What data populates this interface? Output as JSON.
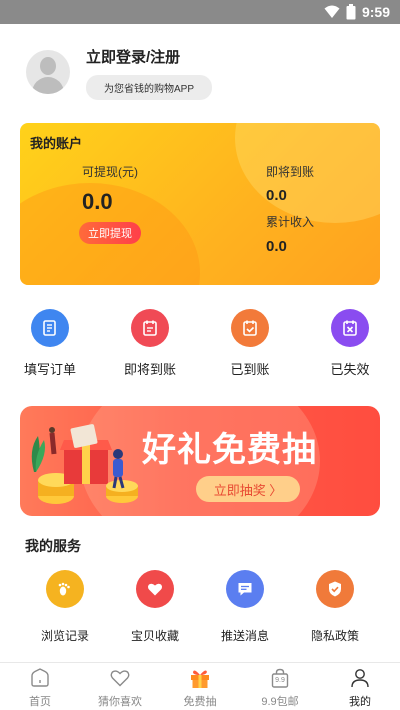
{
  "status_bar": {
    "time": "9:59"
  },
  "profile": {
    "title": "立即登录/注册",
    "slogan": "为您省钱的购物APP"
  },
  "account": {
    "title": "我的账户",
    "withdrawable_label": "可提现(元)",
    "withdrawable_value": "0.0",
    "withdraw_button": "立即提现",
    "pending_label": "即将到账",
    "pending_value": "0.0",
    "total_label": "累计收入",
    "total_value": "0.0"
  },
  "orders": [
    {
      "label": "填写订单",
      "icon": "edit-order-icon",
      "color": "#3f86f0"
    },
    {
      "label": "即将到账",
      "icon": "pending-icon",
      "color": "#f04a55"
    },
    {
      "label": "已到账",
      "icon": "received-icon",
      "color": "#f27a3a"
    },
    {
      "label": "已失效",
      "icon": "expired-icon",
      "color": "#8a4cf0"
    }
  ],
  "banner": {
    "title": "好礼免费抽",
    "button": "立即抽奖 〉"
  },
  "services": {
    "title": "我的服务",
    "items": [
      {
        "label": "浏览记录",
        "icon": "footprint-icon",
        "color": "#f5b320"
      },
      {
        "label": "宝贝收藏",
        "icon": "heart-icon",
        "color": "#f04a4a"
      },
      {
        "label": "推送消息",
        "icon": "message-icon",
        "color": "#5b7ef0"
      },
      {
        "label": "隐私政策",
        "icon": "shield-icon",
        "color": "#f07a3a"
      }
    ]
  },
  "tabs": [
    {
      "label": "首页",
      "icon": "home-icon"
    },
    {
      "label": "猜你喜欢",
      "icon": "heart-outline-icon"
    },
    {
      "label": "免费抽",
      "icon": "gift-icon",
      "color": "#ff8a1f"
    },
    {
      "label": "9.9包邮",
      "icon": "shopping-bag-icon",
      "badge": "9.9"
    },
    {
      "label": "我的",
      "icon": "person-icon",
      "active": true
    }
  ]
}
